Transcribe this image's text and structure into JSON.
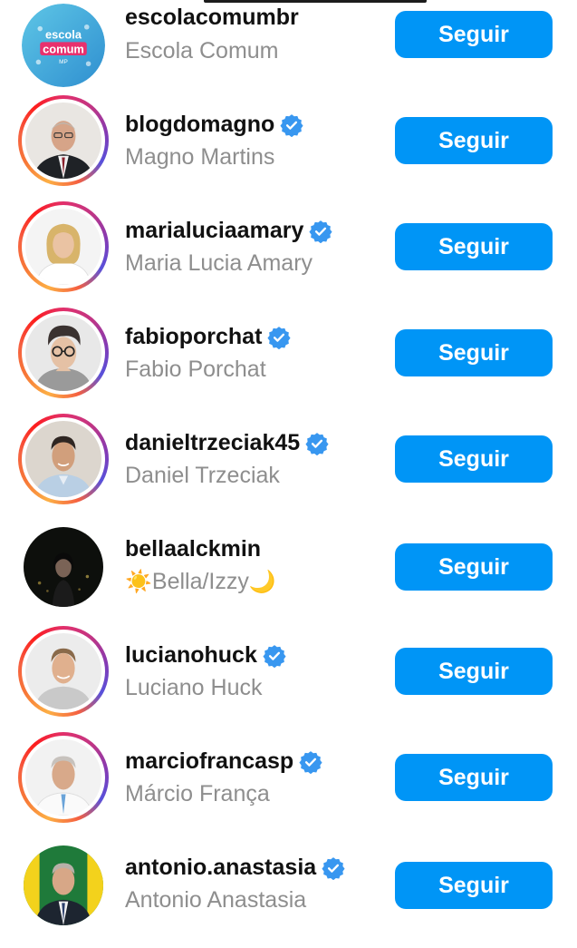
{
  "accounts": [
    {
      "username": "escolacomumbr",
      "name": "Escola Comum",
      "verified": false,
      "ring": false,
      "avatar": "escola-comum-logo",
      "logo_text": [
        "escola",
        "comum",
        "MP"
      ]
    },
    {
      "username": "blogdomagno",
      "name": "Magno Martins",
      "verified": true,
      "ring": true,
      "avatar": "man-in-suit"
    },
    {
      "username": "marialuciaamary",
      "name": "Maria Lucia Amary",
      "verified": true,
      "ring": true,
      "avatar": "woman-blonde"
    },
    {
      "username": "fabioporchat",
      "name": "Fabio Porchat",
      "verified": true,
      "ring": true,
      "avatar": "man-glasses"
    },
    {
      "username": "danieltrzeciak45",
      "name": "Daniel Trzeciak",
      "verified": true,
      "ring": true,
      "avatar": "man-smiling"
    },
    {
      "username": "bellaalckmin",
      "name": "Bella/Izzy",
      "name_prefix": "☀️",
      "name_suffix": "🌙",
      "verified": false,
      "ring": false,
      "avatar": "woman-night"
    },
    {
      "username": "lucianohuck",
      "name": "Luciano Huck",
      "verified": true,
      "ring": true,
      "avatar": "man-casual"
    },
    {
      "username": "marciofrancasp",
      "name": "Márcio França",
      "verified": true,
      "ring": true,
      "avatar": "man-white-shirt"
    },
    {
      "username": "antonio.anastasia",
      "name": "Antonio Anastasia",
      "verified": true,
      "ring": false,
      "avatar": "man-flag"
    }
  ],
  "follow_label": "Seguir",
  "colors": {
    "button": "#0095f6",
    "verified": "#0095f6",
    "secondary_text": "#8e8e8e"
  }
}
